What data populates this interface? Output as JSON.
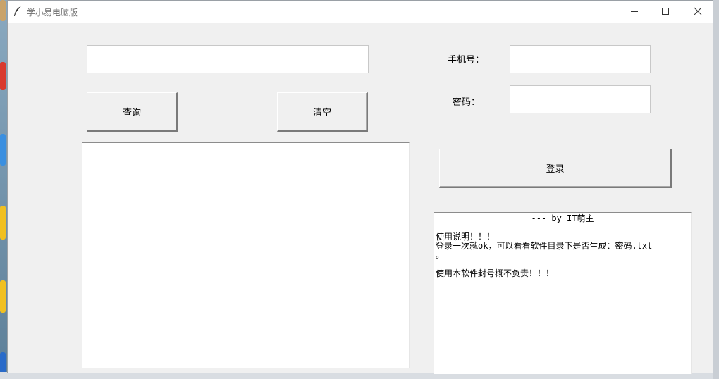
{
  "window": {
    "title": "学小易电脑版",
    "controls": {
      "minimize": "minimize-icon",
      "maximize": "maximize-icon",
      "close": "close-icon"
    }
  },
  "query": {
    "input_value": "",
    "search_label": "查询",
    "clear_label": "清空",
    "result_text": ""
  },
  "login": {
    "phone_label": "手机号：",
    "phone_value": "",
    "password_label": "密码：",
    "password_value": "",
    "button_label": "登录"
  },
  "info": {
    "byline": "--- by IT萌主",
    "blank1": "",
    "heading": "使用说明！！！",
    "line1": "登录一次就ok，可以看看软件目录下是否生成：密码.txt",
    "line1_cont": "。",
    "blank2": "",
    "disclaimer": "使用本软件封号概不负责！！！"
  }
}
